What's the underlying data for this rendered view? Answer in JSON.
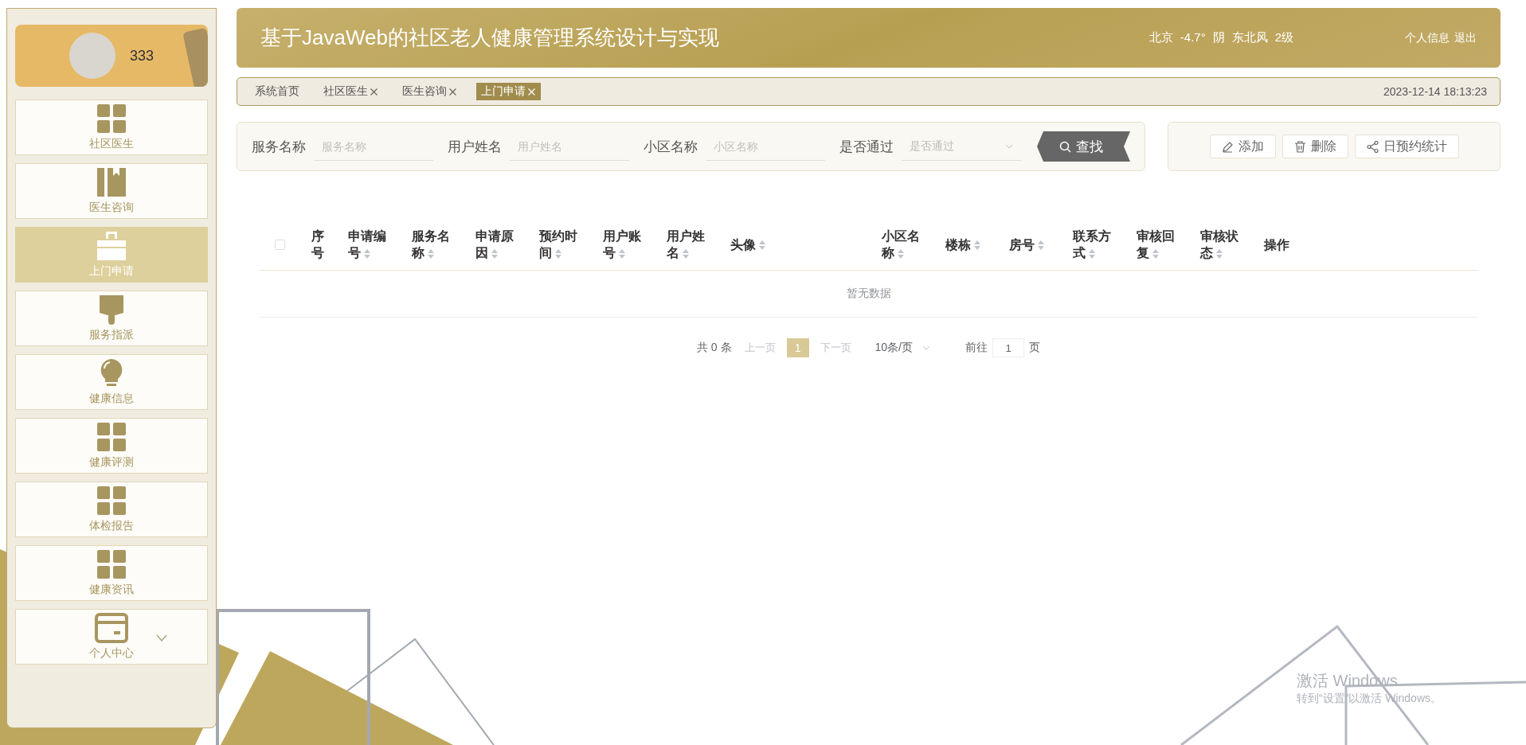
{
  "user": {
    "name": "333"
  },
  "sidebar": {
    "items": [
      {
        "label": "社区医生",
        "kind": "grid",
        "selected": false
      },
      {
        "label": "医生咨询",
        "kind": "book",
        "selected": false
      },
      {
        "label": "上门申请",
        "kind": "briefcase",
        "selected": true
      },
      {
        "label": "服务指派",
        "kind": "brush",
        "selected": false
      },
      {
        "label": "健康信息",
        "kind": "bulb",
        "selected": false
      },
      {
        "label": "健康评测",
        "kind": "grid",
        "selected": false
      },
      {
        "label": "体检报告",
        "kind": "grid",
        "selected": false
      },
      {
        "label": "健康资讯",
        "kind": "grid",
        "selected": false
      },
      {
        "label": "个人中心",
        "kind": "card",
        "selected": false,
        "expanded": false
      }
    ]
  },
  "header": {
    "title": "基于JavaWeb的社区老人健康管理系统设计与实现",
    "weather": {
      "city": "北京",
      "temperature": "-4.7°",
      "condition": "阴",
      "wind": "东北风",
      "wind_level": "2级"
    },
    "links": [
      "个人信息",
      "退出"
    ]
  },
  "tabs": [
    {
      "label": "系统首页",
      "closable": false,
      "selected": false
    },
    {
      "label": "社区医生",
      "closable": true,
      "selected": false
    },
    {
      "label": "医生咨询",
      "closable": true,
      "selected": false
    },
    {
      "label": "上门申请",
      "closable": true,
      "selected": true
    }
  ],
  "datetime": "2023-12-14 18:13:23",
  "search": {
    "fields": [
      {
        "label": "服务名称",
        "placeholder": "服务名称",
        "kind": "text"
      },
      {
        "label": "用户姓名",
        "placeholder": "用户姓名",
        "kind": "text"
      },
      {
        "label": "小区名称",
        "placeholder": "小区名称",
        "kind": "text"
      },
      {
        "label": "是否通过",
        "placeholder": "是否通过",
        "kind": "select"
      }
    ],
    "button": "查找"
  },
  "actions": [
    {
      "label": "添加",
      "kind": "add"
    },
    {
      "label": "删除",
      "kind": "delete"
    },
    {
      "label": "日预约统计",
      "kind": "stats"
    }
  ],
  "table": {
    "select_all_checked": false,
    "columns": [
      {
        "label": "序号",
        "sortable": false
      },
      {
        "label": "申请编号",
        "sortable": true
      },
      {
        "label": "服务名称",
        "sortable": true
      },
      {
        "label": "申请原因",
        "sortable": true
      },
      {
        "label": "预约时间",
        "sortable": true
      },
      {
        "label": "用户账号",
        "sortable": true
      },
      {
        "label": "用户姓名",
        "sortable": true
      },
      {
        "label": "头像",
        "sortable": true
      },
      {
        "label": "小区名称",
        "sortable": true
      },
      {
        "label": "楼栋",
        "sortable": true
      },
      {
        "label": "房号",
        "sortable": true
      },
      {
        "label": "联系方式",
        "sortable": true
      },
      {
        "label": "审核回复",
        "sortable": true
      },
      {
        "label": "审核状态",
        "sortable": true
      },
      {
        "label": "操作",
        "sortable": false
      }
    ],
    "empty_text": "暂无数据"
  },
  "pagination": {
    "total": "共 0 条",
    "prev": "上一页",
    "pages": [
      {
        "label": "1",
        "selected": true
      }
    ],
    "next": "下一页",
    "page_size": "10条/页",
    "goto_label": "前往",
    "goto_value": "1",
    "page_unit": "页"
  },
  "os_notice": {
    "title": "激活 Windows",
    "text": "转到“设置”以激活 Windows。"
  }
}
